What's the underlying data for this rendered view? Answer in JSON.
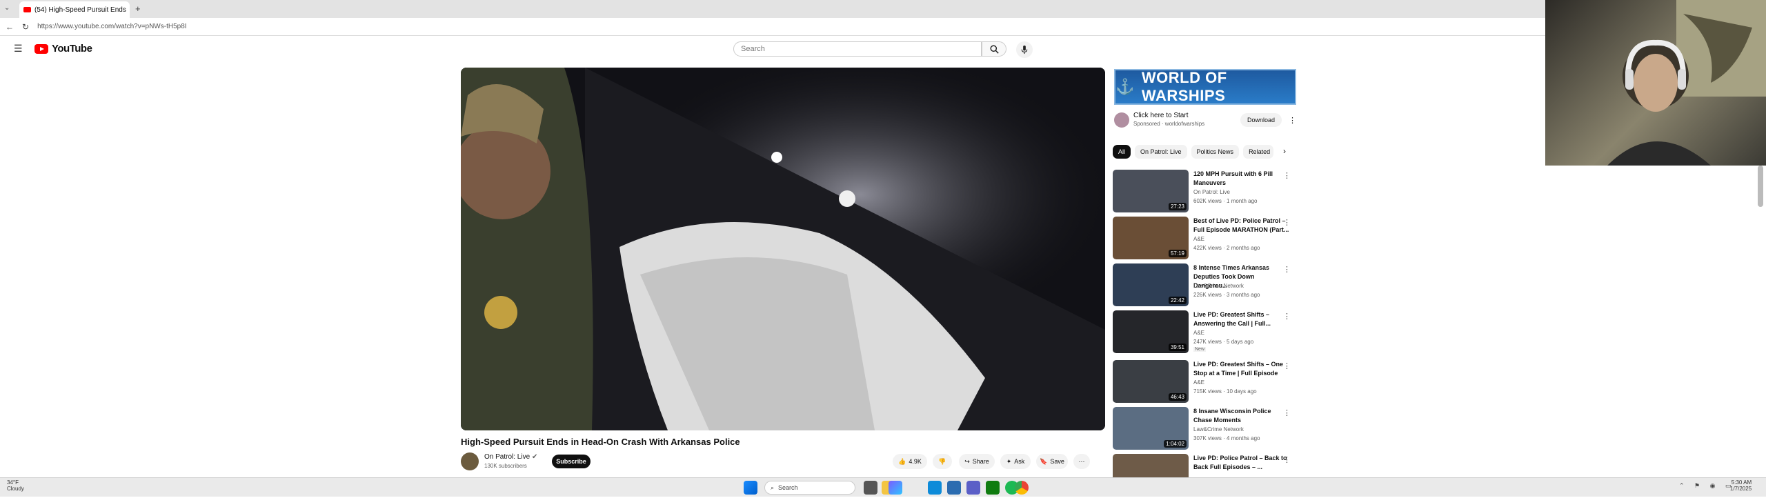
{
  "browser": {
    "tab_title": "(54) High-Speed Pursuit Ends",
    "url": "https://www.youtube.com/watch?v=pNWs-tH5p8I",
    "new_tab_glyph": "+",
    "close_glyph": "×"
  },
  "header": {
    "logo_text": "YouTube",
    "search_placeholder": "Search"
  },
  "video": {
    "title": "High-Speed Pursuit Ends in Head-On Crash With Arkansas Police",
    "channel": "On Patrol: Live",
    "subscribers": "130K subscribers",
    "subscribe_label": "Subscribe",
    "likes": "4.9K",
    "share_label": "Share",
    "ask_label": "Ask",
    "save_label": "Save"
  },
  "ad": {
    "banner_text": "WORLD OF WARSHIPS",
    "title": "Click here to Start",
    "sponsor": "Sponsored · worldofwarships",
    "download_label": "Download"
  },
  "chips": [
    "All",
    "On Patrol: Live",
    "Politics News",
    "Related"
  ],
  "sidebar_videos": [
    {
      "title": "120 MPH Pursuit with 6 Pill Maneuvers",
      "channel": "On Patrol: Live",
      "meta": "602K views · 1 month ago",
      "duration": "27:23",
      "thumb": "#4a4f5a",
      "new": ""
    },
    {
      "title": "Best of Live PD: Police Patrol – Full Episode MARATHON (Part...",
      "channel": "A&E",
      "meta": "422K views · 2 months ago",
      "duration": "57:19",
      "thumb": "#6a4e36",
      "new": ""
    },
    {
      "title": "8 Intense Times Arkansas Deputies Took Down Dangerou...",
      "channel": "Law&Crime Network",
      "meta": "226K views · 3 months ago",
      "duration": "22:42",
      "thumb": "#2e3e55",
      "new": ""
    },
    {
      "title": "Live PD: Greatest Shifts – Answering the Call | Full...",
      "channel": "A&E",
      "meta": "247K views · 5 days ago",
      "duration": "39:51",
      "thumb": "#25262a",
      "new": "New"
    },
    {
      "title": "Live PD: Greatest Shifts – One Stop at a Time | Full Episode",
      "channel": "A&E",
      "meta": "715K views · 10 days ago",
      "duration": "46:43",
      "thumb": "#3a3e44",
      "new": ""
    },
    {
      "title": "8 Insane Wisconsin Police Chase Moments",
      "channel": "Law&Crime Network",
      "meta": "307K views · 4 months ago",
      "duration": "1:04:02",
      "thumb": "#5b6d82",
      "new": ""
    },
    {
      "title": "Live PD: Police Patrol – Back to Back Full Episodes – ...",
      "channel": "",
      "meta": "",
      "duration": "",
      "thumb": "#6e5b48",
      "new": ""
    }
  ],
  "taskbar": {
    "weather_temp": "34°F",
    "weather_desc": "Cloudy",
    "search_label": "Search",
    "time": "5:30 AM",
    "date": "1/7/2025"
  }
}
